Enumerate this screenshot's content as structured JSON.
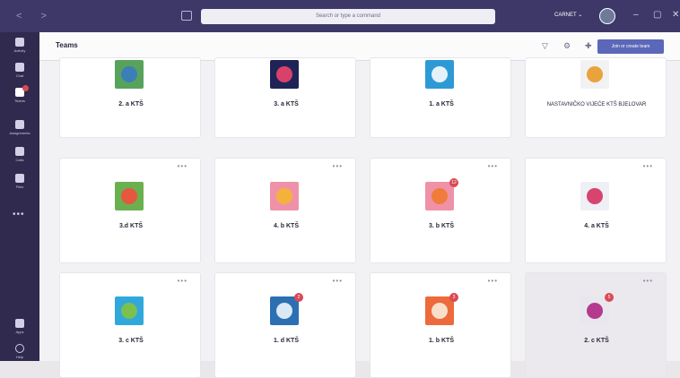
{
  "titlebar": {
    "search_placeholder": "Search or type a command",
    "org": "CARNET ⌄",
    "back_icon": "back-arrow-icon",
    "forward_icon": "forward-arrow-icon"
  },
  "rail": {
    "items": [
      {
        "label": "Activity",
        "icon": "bell-icon"
      },
      {
        "label": "Chat",
        "icon": "chat-icon"
      },
      {
        "label": "Teams",
        "icon": "teams-icon",
        "active": true
      },
      {
        "label": "Assignments",
        "icon": "assignments-icon"
      },
      {
        "label": "Calls",
        "icon": "phone-icon"
      },
      {
        "label": "Files",
        "icon": "file-icon"
      }
    ],
    "more": "•••",
    "bottom": [
      {
        "label": "Apps",
        "icon": "apps-icon"
      },
      {
        "label": "Help",
        "icon": "help-icon"
      }
    ]
  },
  "header": {
    "title": "Teams",
    "join_button": "Join or create team"
  },
  "teams": [
    {
      "name": "2. a KTŠ",
      "color": "#58a35c",
      "glyph": "#3c7fb8",
      "icon": "globe-icon",
      "badge": ""
    },
    {
      "name": "3. a KTŠ",
      "color": "#1f2457",
      "glyph": "#d8416a",
      "icon": "dna-icon",
      "badge": ""
    },
    {
      "name": "1. a KTŠ",
      "color": "#2d9ad6",
      "glyph": "#e6f2fb",
      "icon": "notebook-icon",
      "badge": ""
    },
    {
      "name": "NASTAVNIČKO VIJEĆE KTŠ BJELOVAR",
      "color": "#f2f2f2",
      "glyph": "#e9a33c",
      "icon": "brain-icon",
      "badge": ""
    },
    {
      "name": "3.d KTŠ",
      "color": "#6bb04f",
      "glyph": "#e5573f",
      "icon": "speech-bubbles-icon",
      "badge": ""
    },
    {
      "name": "4. b KTŠ",
      "color": "#ef92a8",
      "glyph": "#f4b23d",
      "icon": "hexagons-icon",
      "badge": ""
    },
    {
      "name": "3. b KTŠ",
      "color": "#ef92a8",
      "glyph": "#f07c3c",
      "icon": "hexagons-icon",
      "badge": "12"
    },
    {
      "name": "4. a KTŠ",
      "color": "#eef0f6",
      "glyph": "#d74470",
      "icon": "chart-line-icon",
      "badge": ""
    },
    {
      "name": "3. c KTŠ",
      "color": "#31a8dc",
      "glyph": "#7cc04f",
      "icon": "plant-icon",
      "badge": ""
    },
    {
      "name": "1. d KTŠ",
      "color": "#2c6fb3",
      "glyph": "#dbe9f5",
      "icon": "microscope-icon",
      "badge": "2"
    },
    {
      "name": "1. b KTŠ",
      "color": "#ec6a3c",
      "glyph": "#f8dfc9",
      "icon": "theater-masks-icon",
      "badge": "3"
    },
    {
      "name": "2. c KTŠ",
      "color": "#e9e7ee",
      "glyph": "#b53a8e",
      "icon": "book-icon",
      "badge": "5",
      "selected": true
    }
  ]
}
